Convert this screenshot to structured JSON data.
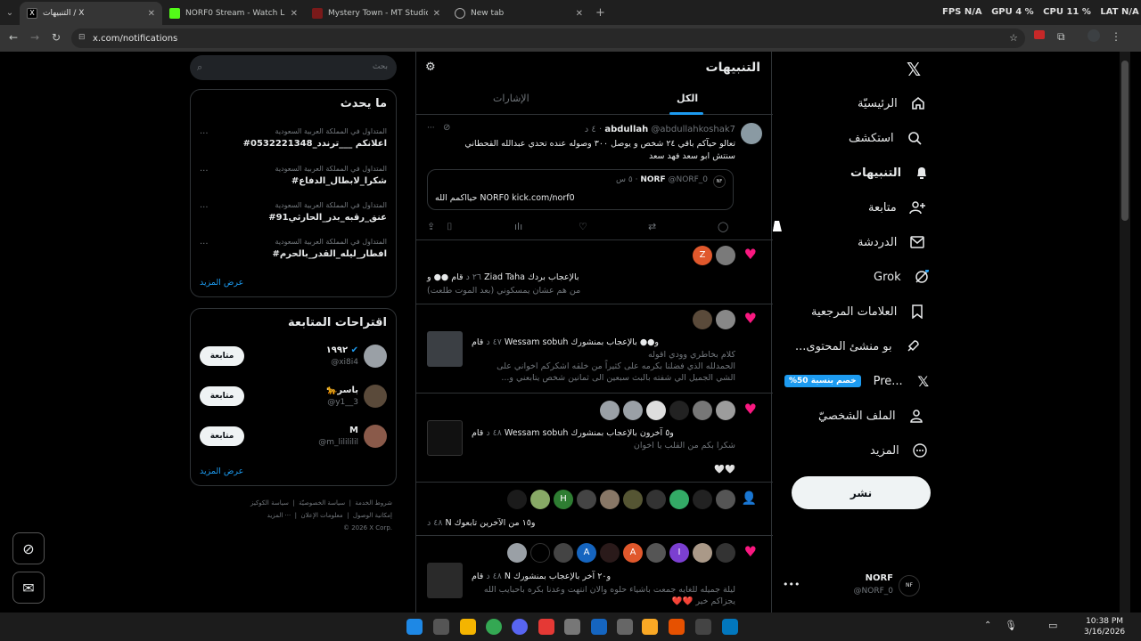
{
  "browser": {
    "tabs": [
      {
        "title": "التنبيهات / X",
        "active": true
      },
      {
        "title": "NORF0 Stream - Watch Live on"
      },
      {
        "title": "Mystery Town - MT Studios | M"
      },
      {
        "title": "New tab"
      }
    ],
    "url": "x.com/notifications",
    "perf": {
      "fps_label": "FPS",
      "fps": "N/A",
      "gpu_label": "GPU",
      "gpu": "4 %",
      "cpu_label": "CPU",
      "cpu": "11 %",
      "lat_label": "LAT",
      "lat": "N/A"
    }
  },
  "sidebar": {
    "items": [
      {
        "label": "الرئيسيّة",
        "icon": "home-icon"
      },
      {
        "label": "استكشف",
        "icon": "search-icon"
      },
      {
        "label": "التنبيهات",
        "icon": "bell-icon"
      },
      {
        "label": "متابعة",
        "icon": "add-user-icon"
      },
      {
        "label": "الدردشة",
        "icon": "mail-icon"
      },
      {
        "label": "Grok",
        "icon": "grok-icon"
      },
      {
        "label": "العلامات المرجعية",
        "icon": "bookmark-icon"
      },
      {
        "label": "...بو منشئ المحتوى",
        "icon": "rocket-icon"
      },
      {
        "label": "Pre...",
        "icon": "x-logo-icon",
        "badge": "%خصم بنسبة 50"
      },
      {
        "label": "الملف الشخصيّ",
        "icon": "profile-icon"
      },
      {
        "label": "المزيد",
        "icon": "more-icon"
      }
    ],
    "post_label": "نشر",
    "account": {
      "name": "NORF",
      "handle": "@NORF_0"
    }
  },
  "notifications": {
    "title": "التنبيهات",
    "tabs": [
      "الكل",
      "الإشارات"
    ],
    "mention": {
      "author": "abdullah",
      "handle": "@abdullahkoshak7",
      "time": "٤ د",
      "text1": "تعالو حيآكم باقي ٢٤ شخص و يوصل ٣٠٠ وصوله عنده تحدي عبدالله القحطاني",
      "text2": "سنتش ابو سعد فهد سعد",
      "quote_author": "NORF",
      "quote_handle": "@NORF_0",
      "quote_time": "٥ س",
      "quote_text": "حيااكمم الله NORF0 kick.com/norf0"
    },
    "n1": {
      "line": "قام ●● و Ziad Taha بالإعجاب بردك",
      "time": "٢٦ د",
      "sub": "من هم عشان يمسكوني (بعد الموت طلعت)"
    },
    "n2": {
      "line": "قام Wessam sobuh و●● بالإعجاب بمنشورك",
      "time": "٤٧ د",
      "l1": "كلام بخاطري وودي اقوله",
      "l2": "الحمدلله الذي فضلنا بكرمه على كثيراً من خلقه اشكركم اخواني على",
      "l3": "الشي الجميل الي شفته بالبث سبعين الى ثمانين شخص يتابعني و..."
    },
    "n3": {
      "line": "قام Wessam sobuh و٥ آخرون بالإعجاب بمنشورك",
      "time": "٤٨ د",
      "sub": "شكرا بكم من القلب يا اخوان",
      "hearts": "🤍🤍"
    },
    "n4": {
      "line": "N و١٥ من الآخرين تابعوك",
      "time": "٤٨ د"
    },
    "n5": {
      "line": "قام N و٢٠ آخر بالإعجاب بمنشورك",
      "time": "٤٨ د",
      "l1": "ليلة جميله للغايه جمعت باشياء حلوه والان انتهت وعدنا بكره باحبايب الله",
      "l2": "يجزاكم خير ❤️❤️"
    }
  },
  "right": {
    "search_placeholder": "بحث",
    "trends_title": "ما يحدث",
    "trend_meta": "المتداول في المملكة العربية السعودية",
    "trends": [
      "#اعلانكم ___ترندد_0532221348",
      "#شكرا_لابطال_الدفاع",
      "#عنق_رقبه_بدر_الحارثي91",
      "#افطار_ليله_القدر_بالحرم"
    ],
    "show_more": "عرض المزيد",
    "follow_title": "اقتراحات المتابعة",
    "users": [
      {
        "name": "١٩٩٢",
        "handle": "@xi8i4"
      },
      {
        "name": "🐆باسر",
        "handle": "@y1__3"
      },
      {
        "name": "M",
        "handle": "@m_lilililil"
      }
    ],
    "follow_label": "متابعة",
    "footer": [
      "شروط الخدمة",
      "سياسة الخصوصيّة",
      "سياسة الكوكيز",
      "إمكانية الوصول",
      "معلومات الإعلان",
      "··· المزيد",
      "© 2026 X Corp."
    ]
  },
  "taskbar": {
    "time": "10:38 PM",
    "date": "3/16/2026"
  },
  "colors": {
    "accent": "#1d9bf0",
    "like": "#f91880",
    "premium": "#1d9bf0"
  }
}
